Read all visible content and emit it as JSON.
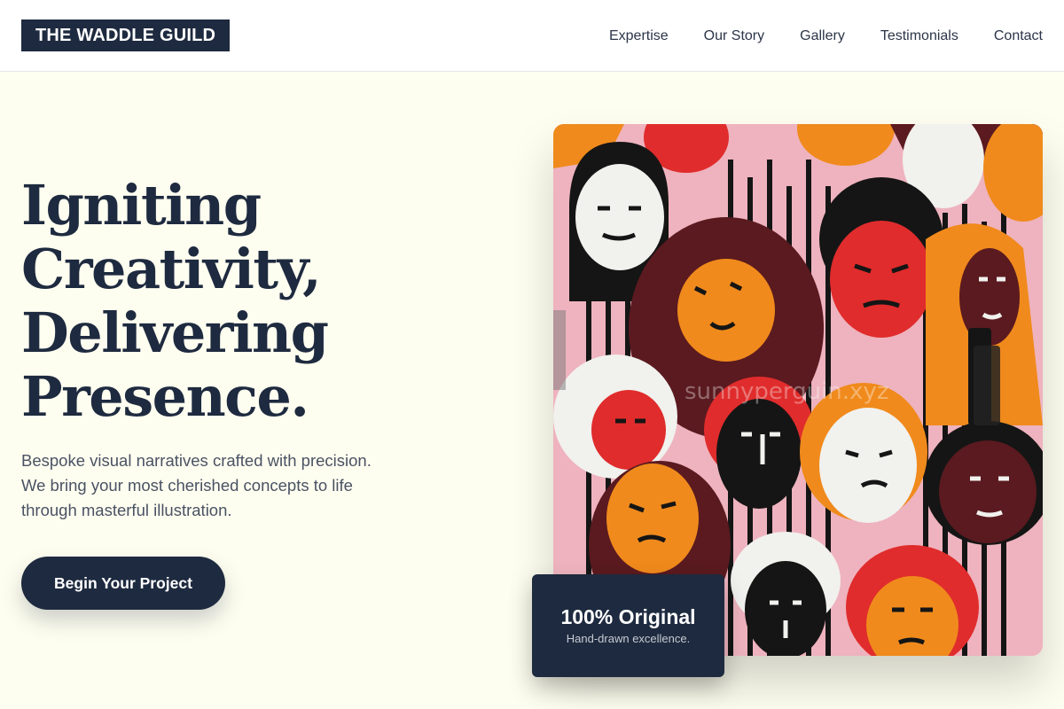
{
  "brand": {
    "logo_text": "THE WADDLE GUILD"
  },
  "nav": {
    "items": [
      {
        "label": "Expertise"
      },
      {
        "label": "Our Story"
      },
      {
        "label": "Gallery"
      },
      {
        "label": "Testimonials"
      },
      {
        "label": "Contact"
      }
    ]
  },
  "hero": {
    "title_lines": [
      "Igniting",
      "Creativity,",
      "Delivering",
      "Presence."
    ],
    "subtitle_lines": [
      "Bespoke visual narratives crafted with precision.",
      "We bring your most cherished concepts to life",
      "through masterful illustration."
    ],
    "cta_label": "Begin Your Project"
  },
  "artwork": {
    "watermark": "sunnyperguin.xyz",
    "background": "#eeb3be"
  },
  "badge": {
    "title": "100% Original",
    "subtitle": "Hand-drawn excellence."
  },
  "colors": {
    "navy": "#1e2a3f",
    "cream": "#fefef0",
    "pink": "#eeb3be",
    "orange": "#f08a1c",
    "red": "#e02c2c",
    "maroon": "#5a1a1f",
    "black": "#151515",
    "white": "#f1f1ee"
  }
}
